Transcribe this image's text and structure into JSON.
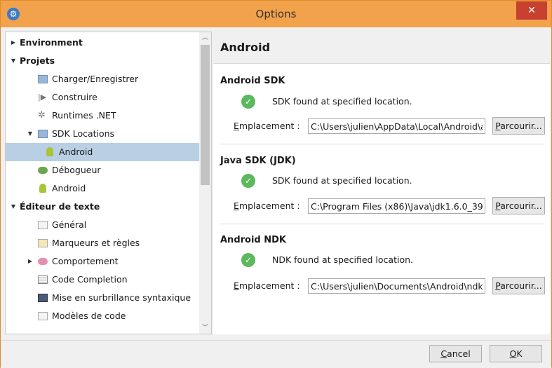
{
  "window": {
    "title": "Options",
    "close_glyph": "✕",
    "app_icon": "monodevelop-icon"
  },
  "tree": {
    "items": [
      {
        "label": "Environment",
        "bold": true,
        "arrow": "▶"
      },
      {
        "label": "Projets",
        "bold": true,
        "arrow": "▼"
      },
      {
        "label": "Charger/Enregistrer",
        "icon": "folder-icon"
      },
      {
        "label": "Construire",
        "icon": "build-icon"
      },
      {
        "label": "Runtimes .NET",
        "icon": "gear-icon"
      },
      {
        "label": "SDK Locations",
        "icon": "folder-icon",
        "arrow": "▼"
      },
      {
        "label": "Android",
        "icon": "android-icon",
        "selected": true
      },
      {
        "label": "Débogueur",
        "icon": "debugger-icon"
      },
      {
        "label": "Android",
        "icon": "android-icon"
      },
      {
        "label": "Éditeur de texte",
        "bold": true,
        "arrow": "▼"
      },
      {
        "label": "Général",
        "icon": "document-icon"
      },
      {
        "label": "Marqueurs et règles",
        "icon": "markers-icon"
      },
      {
        "label": "Comportement",
        "icon": "behavior-icon",
        "arrow": "▶"
      },
      {
        "label": "Code Completion",
        "icon": "list-icon"
      },
      {
        "label": "Mise en surbrillance syntaxique",
        "icon": "highlight-icon"
      },
      {
        "label": "Modèles de code",
        "icon": "template-icon"
      }
    ]
  },
  "page": {
    "title": "Android",
    "location_label_prefix": "E",
    "location_label_rest": "mplacement :",
    "browse_label_prefix": "P",
    "browse_label_rest": "arcourir...",
    "sections": [
      {
        "title": "Android SDK",
        "status": "SDK found at specified location.",
        "path": "C:\\Users\\julien\\AppData\\Local\\Android\\android-sdk"
      },
      {
        "title": "Java SDK (JDK)",
        "status": "SDK found at specified location.",
        "path": "C:\\Program Files (x86)\\Java\\jdk1.6.0_39"
      },
      {
        "title": "Android NDK",
        "status": "NDK found at specified location.",
        "path": "C:\\Users\\julien\\Documents\\Android\\ndk"
      }
    ]
  },
  "footer": {
    "cancel_prefix": "C",
    "cancel_rest": "ancel",
    "ok_prefix": "O",
    "ok_rest": "K"
  },
  "colors": {
    "titlebar": "#f3a24c",
    "selected": "#b8cfe4",
    "check": "#5cb85c",
    "close": "#c8402f"
  }
}
